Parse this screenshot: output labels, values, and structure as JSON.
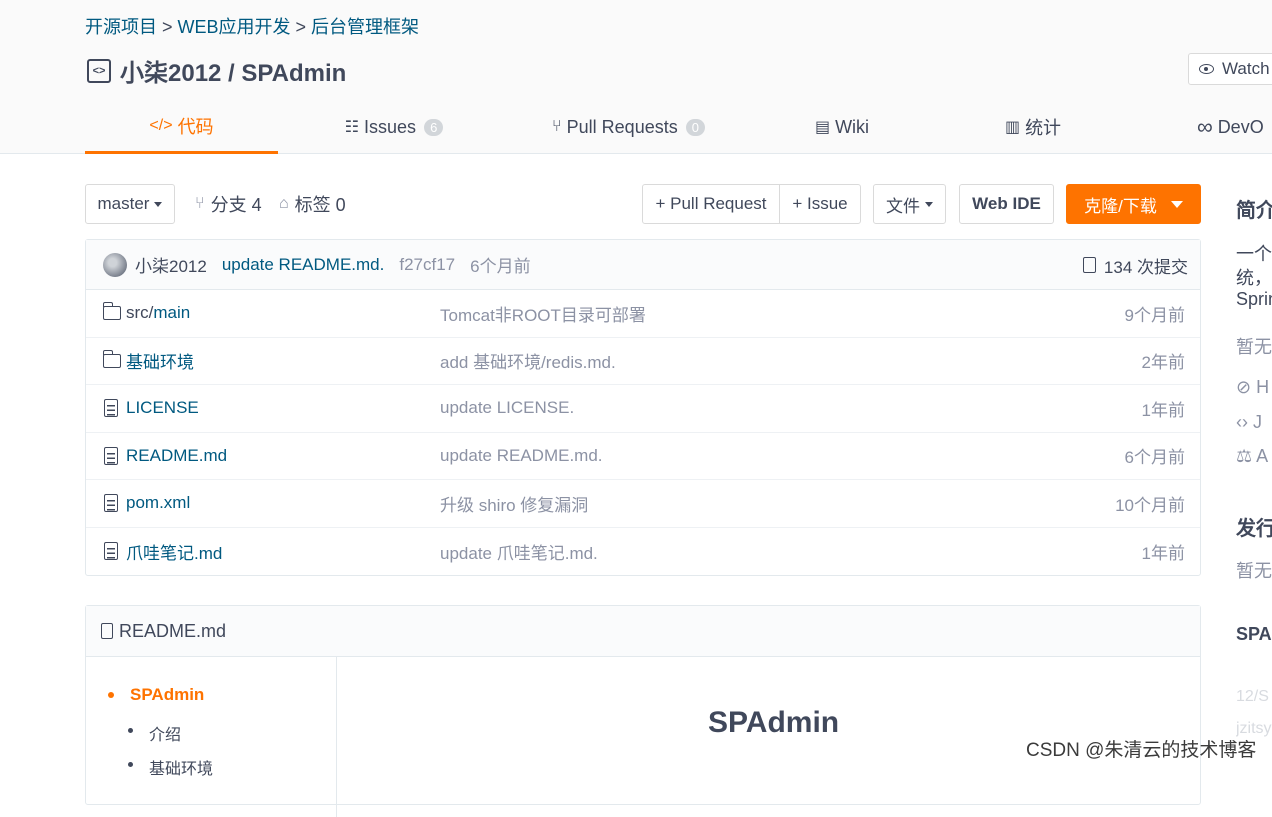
{
  "breadcrumb": [
    "开源项目",
    "WEB应用开发",
    "后台管理框架"
  ],
  "breadcrumb_sep": ">",
  "repo": {
    "owner": "小柒2012",
    "name": "SPAdmin",
    "title": "小柒2012 / SPAdmin",
    "icon": "repo-code-icon"
  },
  "watch_label": "Watch",
  "tabs": [
    {
      "label": "代码",
      "icon": "</>",
      "active": true
    },
    {
      "label": "Issues",
      "icon": "issues-icon",
      "count": "6"
    },
    {
      "label": "Pull Requests",
      "icon": "pull-request-icon",
      "count": "0"
    },
    {
      "label": "Wiki",
      "icon": "wiki-icon"
    },
    {
      "label": "统计",
      "icon": "chart-icon"
    },
    {
      "label": "DevO",
      "icon": "devops-icon"
    }
  ],
  "toolbar": {
    "branch": "master",
    "branches": "分支 4",
    "tags": "标签 0",
    "pull_request": "+ Pull Request",
    "issue": "+ Issue",
    "files": "文件",
    "web_ide": "Web IDE",
    "clone": "克隆/下载"
  },
  "commit": {
    "author": "小柒2012",
    "message": "update README.md.",
    "sha": "f27cf17",
    "time": "6个月前",
    "count": "134 次提交"
  },
  "files": [
    {
      "type": "folder",
      "name_dim": "src/",
      "name": "main",
      "message": "Tomcat非ROOT目录可部署",
      "time": "9个月前"
    },
    {
      "type": "folder",
      "name_dim": "",
      "name": "基础环境",
      "message": "add 基础环境/redis.md.",
      "time": "2年前"
    },
    {
      "type": "file",
      "name_dim": "",
      "name": "LICENSE",
      "message": "update LICENSE.",
      "time": "1年前"
    },
    {
      "type": "file",
      "name_dim": "",
      "name": "README.md",
      "message": "update README.md.",
      "time": "6个月前"
    },
    {
      "type": "file",
      "name_dim": "",
      "name": "pom.xml",
      "message": "升级 shiro 修复漏洞",
      "time": "10个月前"
    },
    {
      "type": "file",
      "name_dim": "",
      "name": "爪哇笔记.md",
      "message": "update 爪哇笔记.md.",
      "time": "1年前"
    }
  ],
  "readme": {
    "filename": "README.md",
    "toc": [
      "SPAdmin",
      "介绍",
      "基础环境"
    ],
    "heading": "SPAdmin"
  },
  "sidebar": {
    "intro_title": "简介",
    "intro_line1": "一个",
    "intro_line2": "统，",
    "intro_line3": "Sprin",
    "no_site": "暂无",
    "tag_h": "H",
    "lang_j": "J",
    "license_a": "A",
    "release_title": "发行",
    "release_none": "暂无",
    "project_title": "SPA",
    "faint1": "12/S",
    "faint2": "jzitsy"
  },
  "watermark": "CSDN @朱清云的技术博客",
  "colors": {
    "accent": "#fe7300",
    "link": "#005980",
    "muted": "#8c92a4"
  }
}
